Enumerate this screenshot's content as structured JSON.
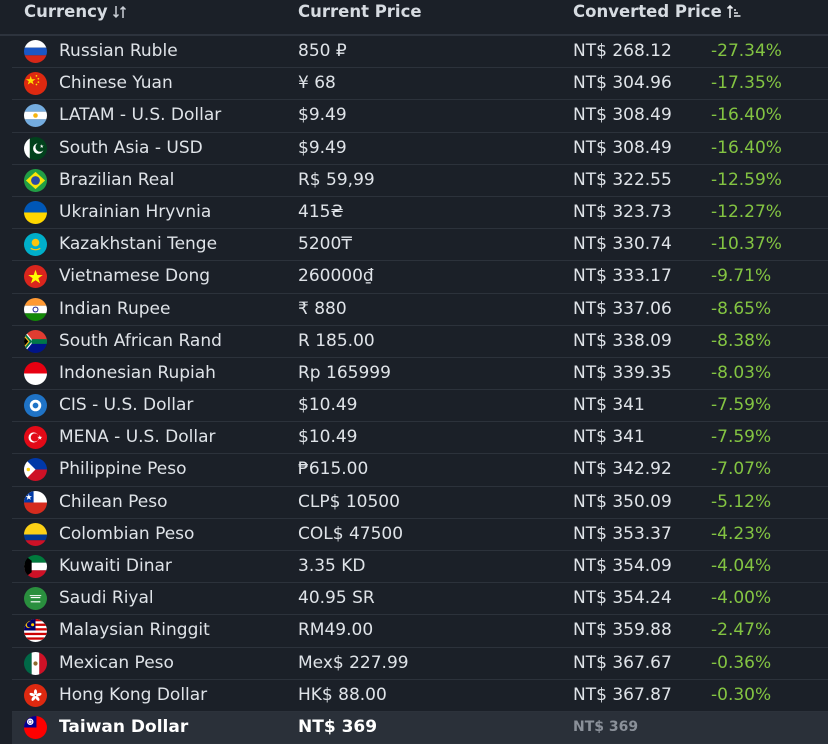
{
  "header": {
    "currency_label": "Currency",
    "current_price_label": "Current Price",
    "converted_price_label": "Converted Price"
  },
  "rows": [
    {
      "name": "Russian Ruble",
      "price": "850 ₽",
      "converted": "NT$ 268.12",
      "pct": "-27.34%",
      "flag": "ru"
    },
    {
      "name": "Chinese Yuan",
      "price": "¥ 68",
      "converted": "NT$ 304.96",
      "pct": "-17.35%",
      "flag": "cn"
    },
    {
      "name": "LATAM - U.S. Dollar",
      "price": "$9.49",
      "converted": "NT$ 308.49",
      "pct": "-16.40%",
      "flag": "ar"
    },
    {
      "name": "South Asia - USD",
      "price": "$9.49",
      "converted": "NT$ 308.49",
      "pct": "-16.40%",
      "flag": "pk"
    },
    {
      "name": "Brazilian Real",
      "price": "R$ 59,99",
      "converted": "NT$ 322.55",
      "pct": "-12.59%",
      "flag": "br"
    },
    {
      "name": "Ukrainian Hryvnia",
      "price": "415₴",
      "converted": "NT$ 323.73",
      "pct": "-12.27%",
      "flag": "ua"
    },
    {
      "name": "Kazakhstani Tenge",
      "price": "5200₸",
      "converted": "NT$ 330.74",
      "pct": "-10.37%",
      "flag": "kz"
    },
    {
      "name": "Vietnamese Dong",
      "price": "260000₫",
      "converted": "NT$ 333.17",
      "pct": "-9.71%",
      "flag": "vn"
    },
    {
      "name": "Indian Rupee",
      "price": "₹ 880",
      "converted": "NT$ 337.06",
      "pct": "-8.65%",
      "flag": "in"
    },
    {
      "name": "South African Rand",
      "price": "R 185.00",
      "converted": "NT$ 338.09",
      "pct": "-8.38%",
      "flag": "za"
    },
    {
      "name": "Indonesian Rupiah",
      "price": "Rp 165999",
      "converted": "NT$ 339.35",
      "pct": "-8.03%",
      "flag": "id"
    },
    {
      "name": "CIS - U.S. Dollar",
      "price": "$10.49",
      "converted": "NT$ 341",
      "pct": "-7.59%",
      "flag": "cis"
    },
    {
      "name": "MENA - U.S. Dollar",
      "price": "$10.49",
      "converted": "NT$ 341",
      "pct": "-7.59%",
      "flag": "tr"
    },
    {
      "name": "Philippine Peso",
      "price": "₱615.00",
      "converted": "NT$ 342.92",
      "pct": "-7.07%",
      "flag": "ph"
    },
    {
      "name": "Chilean Peso",
      "price": "CLP$ 10500",
      "converted": "NT$ 350.09",
      "pct": "-5.12%",
      "flag": "cl"
    },
    {
      "name": "Colombian Peso",
      "price": "COL$ 47500",
      "converted": "NT$ 353.37",
      "pct": "-4.23%",
      "flag": "co"
    },
    {
      "name": "Kuwaiti Dinar",
      "price": "3.35 KD",
      "converted": "NT$ 354.09",
      "pct": "-4.04%",
      "flag": "kw"
    },
    {
      "name": "Saudi Riyal",
      "price": "40.95 SR",
      "converted": "NT$ 354.24",
      "pct": "-4.00%",
      "flag": "sa"
    },
    {
      "name": "Malaysian Ringgit",
      "price": "RM49.00",
      "converted": "NT$ 359.88",
      "pct": "-2.47%",
      "flag": "my"
    },
    {
      "name": "Mexican Peso",
      "price": "Mex$ 227.99",
      "converted": "NT$ 367.67",
      "pct": "-0.36%",
      "flag": "mx"
    },
    {
      "name": "Hong Kong Dollar",
      "price": "HK$ 88.00",
      "converted": "NT$ 367.87",
      "pct": "-0.30%",
      "flag": "hk"
    },
    {
      "name": "Taiwan Dollar",
      "price": "NT$ 369",
      "converted": "NT$ 369",
      "pct": "",
      "flag": "tw",
      "highlight": true
    }
  ],
  "colors": {
    "background": "#1b2028",
    "positive_pct": "#83c442",
    "highlight_row": "#2a3039"
  }
}
